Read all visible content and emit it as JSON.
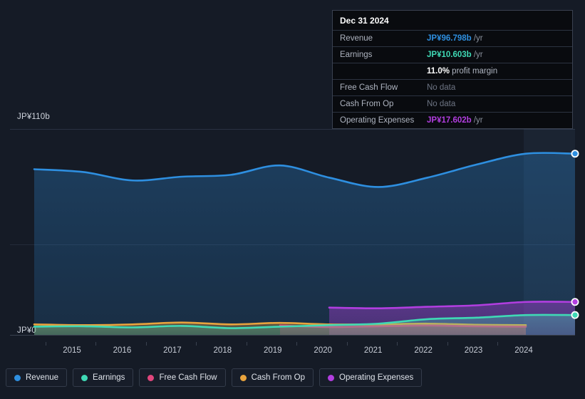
{
  "tooltip": {
    "date": "Dec 31 2024",
    "rows": [
      {
        "label": "Revenue",
        "value": "JP¥96.798b",
        "suffix": "/yr",
        "kind": "rev"
      },
      {
        "label": "Earnings",
        "value": "JP¥10.603b",
        "suffix": "/yr",
        "kind": "earn"
      },
      {
        "label": "",
        "value": "11.0%",
        "suffix": "profit margin",
        "kind": "margin"
      },
      {
        "label": "Free Cash Flow",
        "value": "No data",
        "suffix": "",
        "kind": "nodata"
      },
      {
        "label": "Cash From Op",
        "value": "No data",
        "suffix": "",
        "kind": "nodata"
      },
      {
        "label": "Operating Expenses",
        "value": "JP¥17.602b",
        "suffix": "/yr",
        "kind": "opex"
      }
    ]
  },
  "legend": {
    "items": [
      {
        "label": "Revenue",
        "color": "#2e8fe0"
      },
      {
        "label": "Earnings",
        "color": "#3fd9b5"
      },
      {
        "label": "Free Cash Flow",
        "color": "#e0467c"
      },
      {
        "label": "Cash From Op",
        "color": "#e8a33d"
      },
      {
        "label": "Operating Expenses",
        "color": "#b23ee0"
      }
    ]
  },
  "axes": {
    "y_top_label": "JP¥110b",
    "y_zero_label": "JP¥0",
    "x_labels": [
      "2015",
      "2016",
      "2017",
      "2018",
      "2019",
      "2020",
      "2021",
      "2022",
      "2023",
      "2024"
    ]
  },
  "chart_data": {
    "type": "area",
    "title": "",
    "xlabel": "",
    "ylabel": "JP¥",
    "currency": "JP¥",
    "unit": "billions",
    "ylim": [
      0,
      110
    ],
    "grid": true,
    "gridlines": [
      0,
      55,
      110
    ],
    "legend_position": "bottom-left",
    "x": [
      "2014",
      "2015",
      "2016",
      "2017",
      "2018",
      "2019",
      "2020",
      "2021",
      "2022",
      "2023",
      "2024",
      "2024.9"
    ],
    "x_tick_labels": [
      "2015",
      "2016",
      "2017",
      "2018",
      "2019",
      "2020",
      "2021",
      "2022",
      "2023",
      "2024"
    ],
    "series": [
      {
        "name": "Revenue",
        "color": "#2e8fe0",
        "values": [
          88.5,
          87.0,
          82.5,
          84.5,
          85.5,
          90.5,
          84.0,
          79.0,
          84.0,
          91.0,
          96.8,
          96.798
        ],
        "end_marker": true,
        "end_value": 96.798
      },
      {
        "name": "Earnings",
        "color": "#3fd9b5",
        "values": [
          4.4,
          4.6,
          4.0,
          4.8,
          3.6,
          4.4,
          5.2,
          6.0,
          8.4,
          9.2,
          10.6,
          10.603
        ],
        "end_marker": true,
        "end_value": 10.603
      },
      {
        "name": "Free Cash Flow",
        "color": "#e0467c",
        "values": [
          null,
          null,
          null,
          null,
          null,
          5.0,
          4.2,
          4.6,
          5.0,
          4.6,
          4.4,
          null
        ],
        "starts_at": "2019",
        "end_marker": false
      },
      {
        "name": "Cash From Op",
        "color": "#e8a33d",
        "values": [
          5.6,
          5.2,
          5.6,
          6.6,
          5.6,
          6.4,
          5.6,
          5.6,
          6.0,
          5.4,
          5.2,
          null
        ],
        "end_marker": false
      },
      {
        "name": "Operating Expenses",
        "color": "#b23ee0",
        "values": [
          null,
          null,
          null,
          null,
          null,
          null,
          14.6,
          14.2,
          15.0,
          15.8,
          17.6,
          17.602
        ],
        "starts_at": "2020",
        "end_marker": true,
        "end_value": 17.602
      }
    ],
    "highlight_period": "2024"
  }
}
